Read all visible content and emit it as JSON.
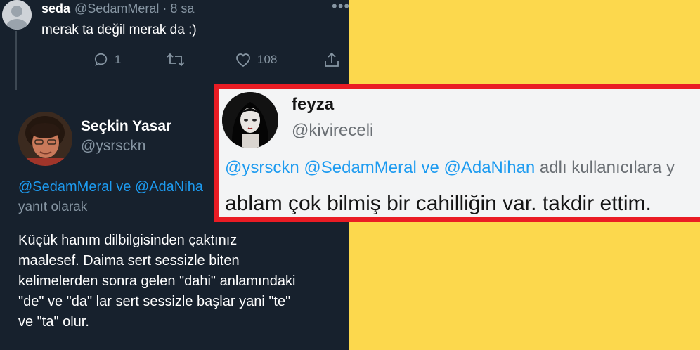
{
  "tweet1": {
    "name": "seda",
    "handle": "@SedamMeral",
    "time": "· 8 sa",
    "more": "•••",
    "text": "merak ta değil merak da :)",
    "reply_count": "1",
    "like_count": "108"
  },
  "tweet2": {
    "name": "Seçkin Yasar",
    "handle": "@ysrsckn",
    "reply_mentions": "@SedamMeral ve @AdaNiha",
    "reply_label": "yanıt olarak",
    "body_lines": [
      "Küçük hanım dilbilgisinden çaktınız",
      "maalesef. Daima sert sessizle biten",
      "kelimelerden sonra gelen \"dahi\" anlamındaki",
      "\"de\" ve \"da\" lar sert sessizle başlar yani \"te\"",
      "ve \"ta\" olur."
    ]
  },
  "tweet3": {
    "name": "feyza",
    "handle": "@kivireceli",
    "reply_mentions": "@ysrsckn @SedamMeral ve @AdaNihan",
    "reply_suffix": "adlı kullanıcılara y",
    "text": "ablam çok bilmiş bir cahilliğin var. takdir ettim."
  },
  "colors": {
    "background": "#fcd84d",
    "dark_panel": "#17212d",
    "highlight_border": "#ea1c24",
    "link": "#1d9bf0",
    "muted": "#8796a3"
  },
  "icons": [
    "reply-icon",
    "retweet-icon",
    "like-icon",
    "share-icon",
    "more-icon"
  ]
}
